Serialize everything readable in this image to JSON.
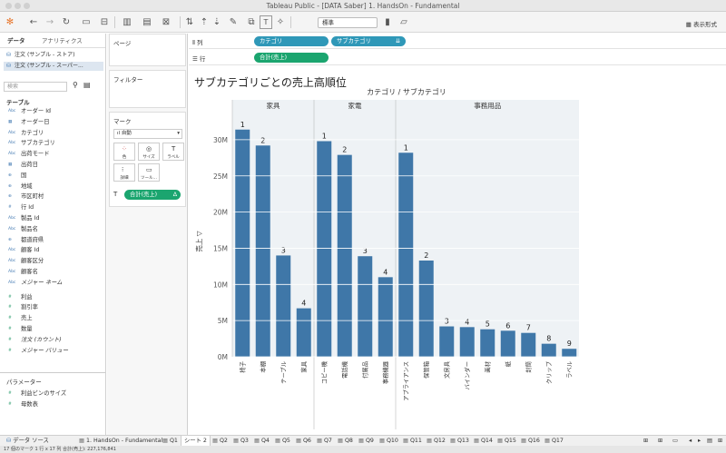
{
  "window": {
    "title": "Tableau Public - [DATA Saber] 1. HandsOn - Fundamental"
  },
  "toolbar": {
    "marks_type": "標準",
    "show_me": "表示形式"
  },
  "left_panel": {
    "tabs": [
      "データ",
      "アナリティクス"
    ],
    "sources": [
      "注文 (サンプル - ストア)",
      "注文 (サンプル - スーパー..."
    ],
    "search_placeholder": "検索",
    "table_header": "テーブル",
    "dimensions": [
      {
        "icon": "Abc",
        "label": "オーダー Id"
      },
      {
        "icon": "▦",
        "label": "オーダー日"
      },
      {
        "icon": "Abc",
        "label": "カテゴリ"
      },
      {
        "icon": "Abc",
        "label": "サブカテゴリ"
      },
      {
        "icon": "Abc",
        "label": "出荷モード"
      },
      {
        "icon": "▦",
        "label": "出荷日"
      },
      {
        "icon": "⊕",
        "label": "国"
      },
      {
        "icon": "⊕",
        "label": "地域"
      },
      {
        "icon": "⊕",
        "label": "市区町村"
      },
      {
        "icon": "#",
        "label": "行 Id"
      },
      {
        "icon": "Abc",
        "label": "製品 Id"
      },
      {
        "icon": "Abc",
        "label": "製品名"
      },
      {
        "icon": "⊕",
        "label": "都道府県"
      },
      {
        "icon": "Abc",
        "label": "顧客 Id"
      },
      {
        "icon": "Abc",
        "label": "顧客区分"
      },
      {
        "icon": "Abc",
        "label": "顧客名"
      },
      {
        "icon": "Abc",
        "label": "メジャー ネーム"
      }
    ],
    "measures": [
      {
        "icon": "#",
        "label": "利益"
      },
      {
        "icon": "#",
        "label": "割引率"
      },
      {
        "icon": "#",
        "label": "売上"
      },
      {
        "icon": "#",
        "label": "数量"
      },
      {
        "icon": "#",
        "label": "注文 (カウント)"
      },
      {
        "icon": "#",
        "label": "メジャー バリュー"
      }
    ],
    "params_header": "パラメーター",
    "params": [
      {
        "icon": "#",
        "label": "利益ビンのサイズ"
      },
      {
        "icon": "#",
        "label": "母数表"
      }
    ]
  },
  "mid_panel": {
    "pages": "ページ",
    "filters": "フィルター",
    "marks": "マーク",
    "mark_type": "自動",
    "mark_buttons": [
      "色",
      "サイズ",
      "ラベル",
      "詳細",
      "ツール..."
    ],
    "mark_pill": "合計(売上)"
  },
  "shelves": {
    "columns_label": "列",
    "rows_label": "行",
    "columns_pills": [
      "カテゴリ",
      "サブカテゴリ"
    ],
    "rows_pills": [
      "合計(売上)"
    ]
  },
  "viz_title": "サブカテゴリごとの売上高順位",
  "chart_data": {
    "type": "bar",
    "header": "カテゴリ / サブカテゴリ",
    "ylabel": "売上 ▽",
    "ylim": [
      0,
      33000000
    ],
    "yticks": [
      {
        "v": 0,
        "l": "0M"
      },
      {
        "v": 5000000,
        "l": "5M"
      },
      {
        "v": 10000000,
        "l": "10M"
      },
      {
        "v": 15000000,
        "l": "15M"
      },
      {
        "v": 20000000,
        "l": "20M"
      },
      {
        "v": 25000000,
        "l": "25M"
      },
      {
        "v": 30000000,
        "l": "30M"
      }
    ],
    "color": "#3f77a8",
    "groups": [
      {
        "name": "家具",
        "items": [
          {
            "label": "椅子",
            "value": 31400000,
            "rank": 1
          },
          {
            "label": "本棚",
            "value": 29200000,
            "rank": 2
          },
          {
            "label": "テーブル",
            "value": 14000000,
            "rank": 3
          },
          {
            "label": "家具",
            "value": 6700000,
            "rank": 4
          }
        ]
      },
      {
        "name": "家電",
        "items": [
          {
            "label": "コピー機",
            "value": 29800000,
            "rank": 1
          },
          {
            "label": "電話機",
            "value": 27900000,
            "rank": 2
          },
          {
            "label": "付属品",
            "value": 13900000,
            "rank": 3
          },
          {
            "label": "事務機器",
            "value": 11000000,
            "rank": 4
          }
        ]
      },
      {
        "name": "事務用品",
        "items": [
          {
            "label": "アプライアンス",
            "value": 28200000,
            "rank": 1
          },
          {
            "label": "保管箱",
            "value": 13300000,
            "rank": 2
          },
          {
            "label": "文房具",
            "value": 4200000,
            "rank": 3
          },
          {
            "label": "バインダー",
            "value": 4100000,
            "rank": 4
          },
          {
            "label": "画材",
            "value": 3800000,
            "rank": 5
          },
          {
            "label": "紙",
            "value": 3600000,
            "rank": 6
          },
          {
            "label": "封筒",
            "value": 3300000,
            "rank": 7
          },
          {
            "label": "クリップ",
            "value": 1800000,
            "rank": 8
          },
          {
            "label": "ラベル",
            "value": 1100000,
            "rank": 9
          }
        ]
      }
    ]
  },
  "bottom_tabs": {
    "datasource": "データ ソース",
    "sheets": [
      "1. HandsOn - Fundamental",
      "Q1",
      "シート 2",
      "Q2",
      "Q3",
      "Q4",
      "Q5",
      "Q6",
      "Q7",
      "Q8",
      "Q9",
      "Q10",
      "Q11",
      "Q12",
      "Q13",
      "Q14",
      "Q15",
      "Q16",
      "Q17"
    ],
    "active": "シート 2"
  },
  "status": "17 個のマーク    1 行 x 17 列    合計(売上): 227,176,841"
}
